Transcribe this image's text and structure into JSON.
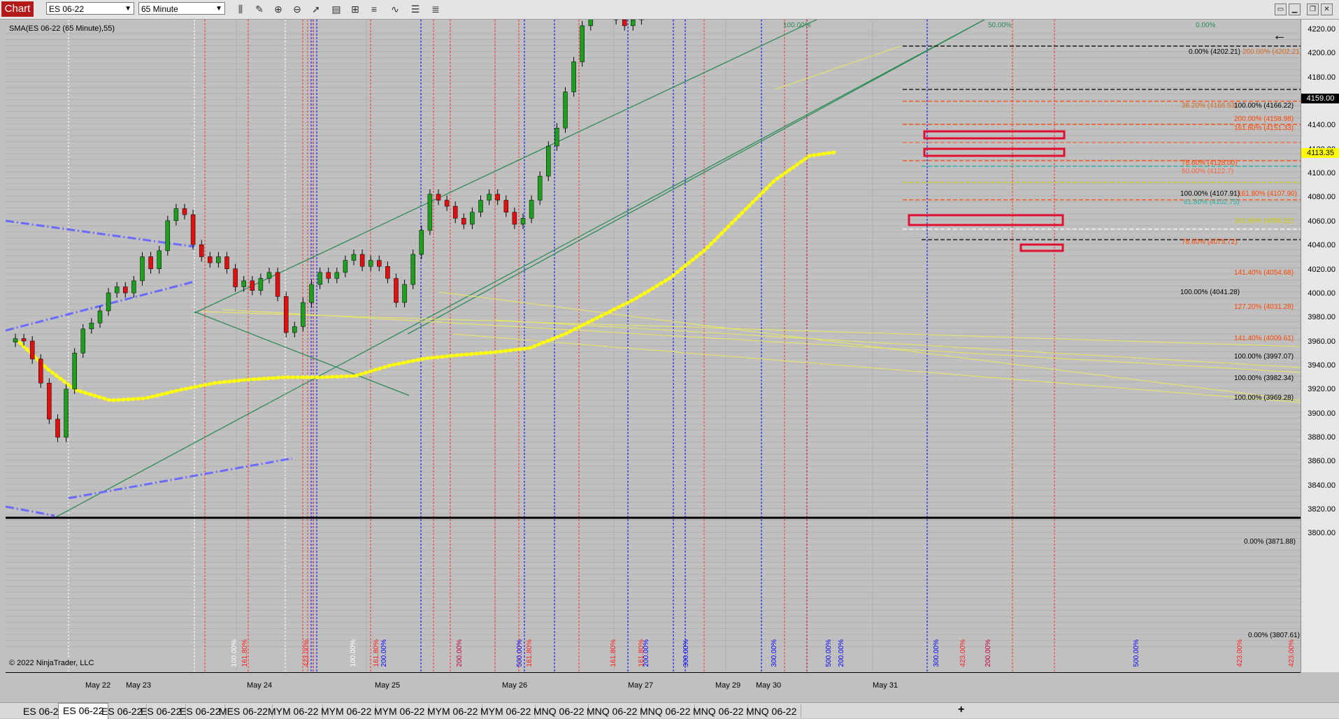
{
  "toolbar": {
    "window_label": "Chart",
    "instrument": "ES 06-22",
    "interval": "65 Minute",
    "icons": [
      "bar-style-icon",
      "draw-pencil-icon",
      "zoom-in-icon",
      "zoom-out-icon",
      "pointer-icon",
      "data-box-icon",
      "chart-trader-icon",
      "strategy-icon",
      "indicator-icon",
      "properties-icon"
    ],
    "window_buttons": [
      "layout-icon",
      "minimize-icon",
      "maximize-icon",
      "close-icon"
    ]
  },
  "chart": {
    "indicator_label": "SMA(ES 06-22 (65 Minute),55)",
    "copyright": "© 2022 NinjaTrader, LLC",
    "top_percent_labels": [
      "100.00%",
      "50.00%",
      "0.00%"
    ],
    "price_ticks": [
      "4220.00",
      "4200.00",
      "4180.00",
      "4160.00",
      "4140.00",
      "4120.00",
      "4100.00",
      "4080.00",
      "4060.00",
      "4040.00",
      "4020.00",
      "4000.00",
      "3980.00",
      "3960.00",
      "3940.00",
      "3920.00",
      "3900.00",
      "3880.00",
      "3860.00",
      "3840.00",
      "3820.00",
      "3800.00"
    ],
    "current_price": "4159.00",
    "sma_price": "4113.35",
    "time_labels": [
      "May 22",
      "May 23",
      "May 24",
      "May 25",
      "May 26",
      "May 27",
      "May 29",
      "May 30",
      "May 31"
    ],
    "fib_labels": [
      {
        "text": "0.00% (4202.21)",
        "color": "#000000"
      },
      {
        "text": "200.00% (4202.21)",
        "color": "#d2691e"
      },
      {
        "text": "38.20% (4166.53)",
        "color": "#d2691e"
      },
      {
        "text": "100.00% (4166.22)",
        "color": "#000000"
      },
      {
        "text": "200.00% (4158.98)",
        "color": "#ff4500"
      },
      {
        "text": "161.80% (4151.33)",
        "color": "#ff4500"
      },
      {
        "text": "78.60% (4128.00)",
        "color": "#ff4500"
      },
      {
        "text": "50.00% (4122.7)",
        "color": "#ff6347"
      },
      {
        "text": "100.00% (4107.91)",
        "color": "#000000"
      },
      {
        "text": "161.80% (4107.90)",
        "color": "#ff4500"
      },
      {
        "text": "61.80% (4102.75)",
        "color": "#20b2aa"
      },
      {
        "text": "161.80% (4090.32)",
        "color": "#cccc00"
      },
      {
        "text": "78.60% (4075.72)",
        "color": "#ff4500"
      },
      {
        "text": "141.40% (4054.68)",
        "color": "#ff4500"
      },
      {
        "text": "100.00% (4041.28)",
        "color": "#000000"
      },
      {
        "text": "127.20% (4031.28)",
        "color": "#ff4500"
      },
      {
        "text": "141.40% (4009.61)",
        "color": "#ff4500"
      },
      {
        "text": "100.00% (3997.07)",
        "color": "#000000"
      },
      {
        "text": "100.00% (3982.34)",
        "color": "#000000"
      },
      {
        "text": "100.00% (3969.28)",
        "color": "#000000"
      },
      {
        "text": "0.00% (3871.88)",
        "color": "#000000"
      },
      {
        "text": "0.00% (3807.61)",
        "color": "#000000"
      }
    ],
    "vertical_labels": [
      {
        "text": "100.00%",
        "color": "#ffffff"
      },
      {
        "text": "161.80%",
        "color": "#ff2020"
      },
      {
        "text": "423.00%",
        "color": "#ff2020"
      },
      {
        "text": "100.00%",
        "color": "#ffffff"
      },
      {
        "text": "161.80%",
        "color": "#ff2020"
      },
      {
        "text": "200.00%",
        "color": "#0000ff"
      },
      {
        "text": "200.00%",
        "color": "#c00040"
      },
      {
        "text": "500.00%",
        "color": "#0000ff"
      },
      {
        "text": "161.80%",
        "color": "#ff2020"
      },
      {
        "text": "161.80%",
        "color": "#ff2020"
      },
      {
        "text": "161.80%",
        "color": "#ff2020"
      },
      {
        "text": "200.00%",
        "color": "#0000ff"
      },
      {
        "text": "300.00%",
        "color": "#0000ff"
      },
      {
        "text": "300.00%",
        "color": "#0000ff"
      },
      {
        "text": "500.00%",
        "color": "#0000ff"
      },
      {
        "text": "200.00%",
        "color": "#0000ff"
      },
      {
        "text": "300.00%",
        "color": "#0000ff"
      },
      {
        "text": "423.00%",
        "color": "#ff2020"
      },
      {
        "text": "200.00%",
        "color": "#c00040"
      },
      {
        "text": "500.00%",
        "color": "#0000ff"
      },
      {
        "text": "423.00%",
        "color": "#ff2020"
      },
      {
        "text": "423.00%",
        "color": "#ff2020"
      }
    ]
  },
  "tabs": [
    "ES 06-22",
    "ES 06-22",
    "ES 06-22",
    "ES 06-22",
    "ES 06-22",
    "MES 06-22",
    "MYM 06-22",
    "MYM 06-22",
    "MYM 06-22",
    "MYM 06-22",
    "MYM 06-22",
    "MNQ 06-22",
    "MNQ 06-22",
    "MNQ 06-22",
    "MNQ 06-22",
    "MNQ 06-22"
  ],
  "active_tab_index": 1,
  "add_tab_label": "+",
  "colors": {
    "up": "#1e9e1e",
    "down": "#e01010",
    "sma": "#ffff00",
    "channel": "#2e8b57"
  }
}
